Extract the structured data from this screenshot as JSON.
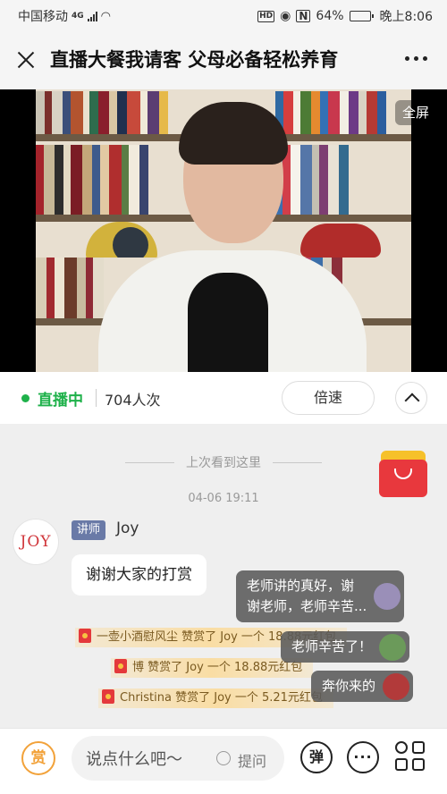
{
  "status_bar": {
    "carrier": "中国移动",
    "network": "4G",
    "battery": "64%",
    "time": "晚上8:06",
    "icons": [
      "signal-icon",
      "wifi-icon",
      "hd-icon",
      "eye-icon",
      "nfc-icon",
      "battery-icon"
    ]
  },
  "header": {
    "title": "直播大餐我请客 父母必备轻松养育",
    "close_icon": "close-icon",
    "more_icon": "more-icon"
  },
  "video": {
    "fullscreen_label": "全屏"
  },
  "live_bar": {
    "status": "直播中",
    "status_color": "#1eb14a",
    "viewers": "704人次",
    "speed_label": "倍速",
    "collapse_icon": "chevron-up-icon"
  },
  "chat": {
    "last_seen": "上次看到这里",
    "timestamp": "04-06 19:11",
    "message": {
      "avatar_text": "JOY",
      "role": "讲师",
      "author": "Joy",
      "text": "谢谢大家的打赏"
    },
    "gifts": [
      {
        "sender": "一壶小酒慰风尘",
        "text": "赞赏了 Joy 一个 18.88元红包"
      },
      {
        "sender": "博",
        "text": "赞赏了 Joy 一个 18.88元红包"
      },
      {
        "sender": "Christina",
        "text": "赞赏了 Joy 一个 5.21元红包"
      }
    ],
    "danmu": [
      {
        "line1": "老师讲的真好，谢",
        "line2": "谢老师，老师辛苦..."
      },
      {
        "line1": "老师辛苦了！"
      },
      {
        "line1": "奔你来的"
      }
    ]
  },
  "bottom_bar": {
    "reward_label": "赏",
    "input_placeholder": "说点什么吧～",
    "ask_label": "提问",
    "danmu_label": "弹"
  }
}
